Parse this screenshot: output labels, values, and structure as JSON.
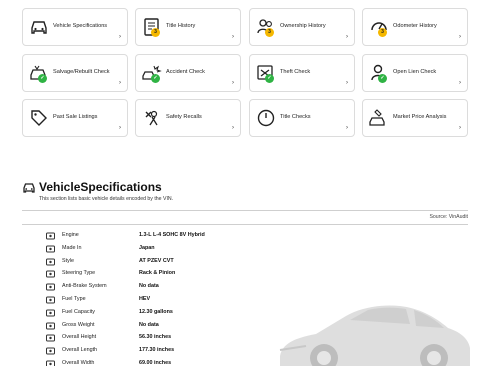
{
  "cards": [
    {
      "label": "Vehicle Specifications",
      "icon": "car-front-icon"
    },
    {
      "label": "Title History",
      "icon": "document-icon",
      "badge": "3"
    },
    {
      "label": "Ownership History",
      "icon": "owners-icon",
      "badge": "3"
    },
    {
      "label": "Odometer History",
      "icon": "odometer-icon",
      "badge": "3"
    },
    {
      "label": "Salvage/Rebuilt Check",
      "icon": "salvage-car-icon",
      "badge_check": true
    },
    {
      "label": "Accident Check",
      "icon": "accident-icon",
      "badge_check": true
    },
    {
      "label": "Theft Check",
      "icon": "theft-icon",
      "badge_check": true
    },
    {
      "label": "Open Lien Check",
      "icon": "lien-icon",
      "badge_check": true
    },
    {
      "label": "Past Sale Listings",
      "icon": "price-tag-icon"
    },
    {
      "label": "Safety Recalls",
      "icon": "recall-icon"
    },
    {
      "label": "Title Checks",
      "icon": "title-check-icon"
    },
    {
      "label": "Market Price Analysis",
      "icon": "market-price-icon"
    }
  ],
  "chevron": "›",
  "section": {
    "title": "VehicleSpecifications",
    "subtitle": "This section lists basic vehicle details encoded by the VIN.",
    "source": "Source: VinAudit"
  },
  "specs": [
    {
      "key": "Engine",
      "value": "1.3-L L-4 SOHC 8V Hybrid",
      "icon": "engine-icon"
    },
    {
      "key": "Made In",
      "value": "Japan",
      "icon": "flag-icon"
    },
    {
      "key": "Style",
      "value": "AT PZEV CVT",
      "icon": "style-icon"
    },
    {
      "key": "Steering Type",
      "value": "Rack & Pinion",
      "icon": "steering-icon"
    },
    {
      "key": "Anti-Brake System",
      "value": "No data",
      "icon": "brake-icon"
    },
    {
      "key": "Fuel Type",
      "value": "HEV",
      "icon": "fuel-icon"
    },
    {
      "key": "Fuel Capacity",
      "value": "12.30 gallons",
      "icon": "fuel-capacity-icon"
    },
    {
      "key": "Gross Weight",
      "value": "No data",
      "icon": "weight-icon"
    },
    {
      "key": "Overall Height",
      "value": "56.30 inches",
      "icon": "height-icon"
    },
    {
      "key": "Overall Length",
      "value": "177.30 inches",
      "icon": "length-icon"
    },
    {
      "key": "Overall Width",
      "value": "69.00 inches",
      "icon": "width-icon"
    }
  ],
  "colors": {
    "badge_number": "#f5b800",
    "badge_check": "#2fb344",
    "border": "#dcdcdc"
  }
}
